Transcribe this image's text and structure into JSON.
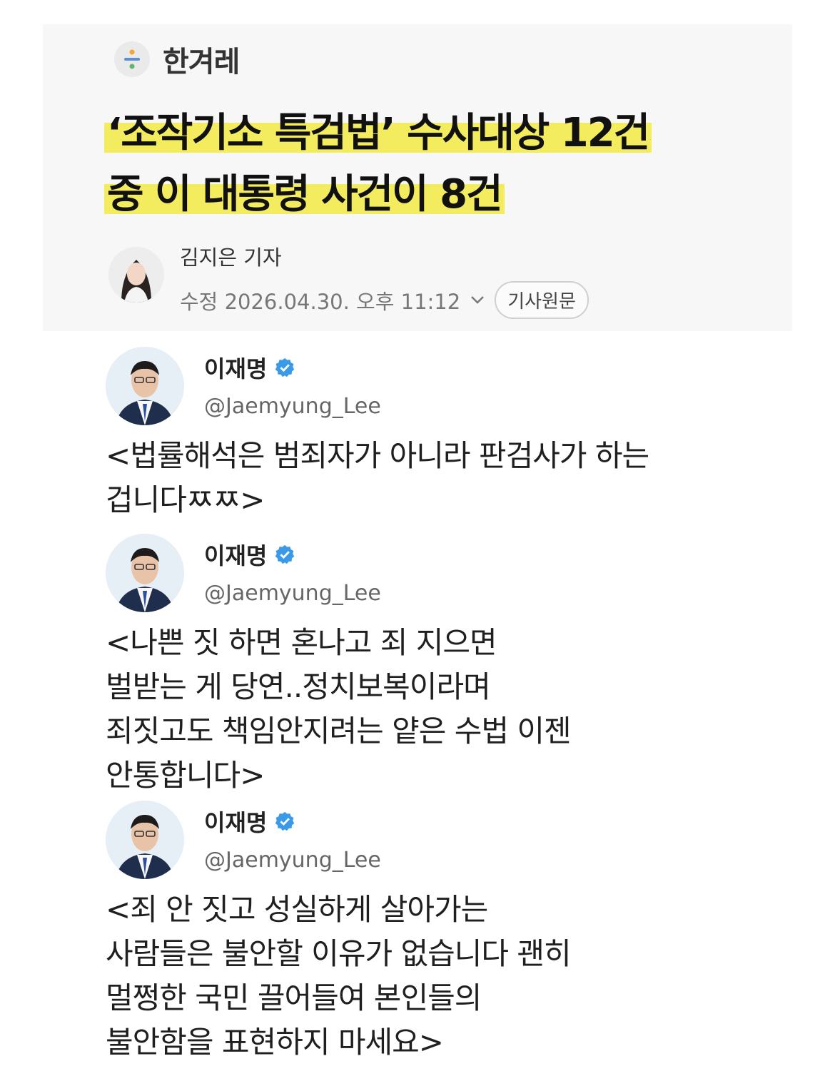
{
  "article": {
    "source": "한겨레",
    "headline_lines": [
      "‘조작기소 특검법’ 수사대상 12건",
      "중 이 대통령 사건이 8건"
    ],
    "reporter": "김지은 기자",
    "modified": "수정 2026.04.30. 오후 11:12",
    "original_button": "기사원문",
    "highlight_color": "#f4ec5f"
  },
  "tweets": [
    {
      "name": "이재명",
      "handle": "@Jaemyung_Lee",
      "verified": true,
      "lines": [
        "<법률해석은 범죄자가 아니라 판검사가 하는",
        "겁니다ㅉㅉ>"
      ]
    },
    {
      "name": "이재명",
      "handle": "@Jaemyung_Lee",
      "verified": true,
      "lines": [
        "<나쁜 짓 하면 혼나고 죄 지으면",
        "벌받는 게 당연..정치보복이라며",
        "죄짓고도 책임안지려는 얕은 수법 이젠",
        "안통합니다>"
      ]
    },
    {
      "name": "이재명",
      "handle": "@Jaemyung_Lee",
      "verified": true,
      "lines": [
        "<죄 안 짓고 성실하게 살아가는",
        "사람들은 불안할 이유가 없습니다 괜히",
        "멀쩡한 국민 끌어들여 본인들의",
        "불안함을 표현하지 마세요>"
      ]
    }
  ]
}
